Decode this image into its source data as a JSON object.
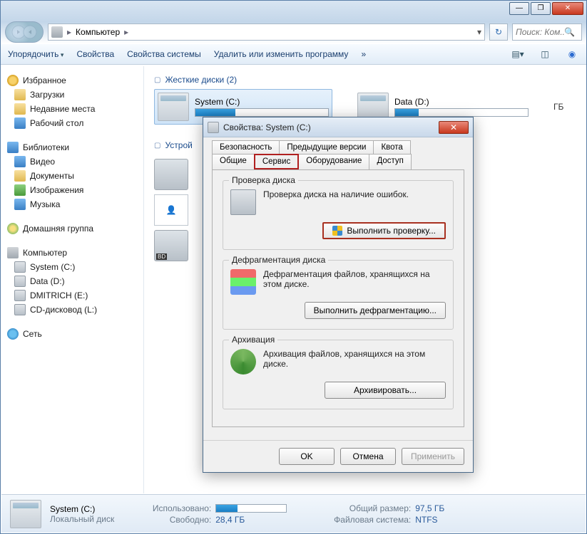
{
  "window_controls": {
    "min": "—",
    "max": "❐",
    "close": "✕"
  },
  "address": {
    "root_icon": "computer",
    "crumb1": "Компьютер",
    "search_placeholder": "Поиск: Ком..."
  },
  "toolbar": {
    "organize": "Упорядочить",
    "properties": "Свойства",
    "sys_properties": "Свойства системы",
    "uninstall": "Удалить или изменить программу",
    "more": "»"
  },
  "sidebar": {
    "favorites": {
      "label": "Избранное",
      "items": [
        "Загрузки",
        "Недавние места",
        "Рабочий стол"
      ]
    },
    "libraries": {
      "label": "Библиотеки",
      "items": [
        "Видео",
        "Документы",
        "Изображения",
        "Музыка"
      ]
    },
    "homegroup": {
      "label": "Домашняя группа"
    },
    "computer": {
      "label": "Компьютер",
      "items": [
        "System (C:)",
        "Data (D:)",
        "DMITRICH (E:)",
        "CD-дисковод (L:)"
      ]
    },
    "network": {
      "label": "Сеть"
    }
  },
  "content": {
    "hdd_header": "Жесткие диски (2)",
    "drives": [
      {
        "name": "System (C:)",
        "fill_pct": 30,
        "selected": true
      },
      {
        "name": "Data (D:)",
        "fill_pct": 18,
        "selected": false,
        "extra": "ГБ"
      }
    ],
    "devices_header": "Устрой"
  },
  "status": {
    "drive_name": "System (C:)",
    "type": "Локальный диск",
    "used_label": "Использовано:",
    "used_bar_pct": 30,
    "free_label": "Свободно:",
    "free_value": "28,4 ГБ",
    "total_label": "Общий размер:",
    "total_value": "97,5 ГБ",
    "fs_label": "Файловая система:",
    "fs_value": "NTFS"
  },
  "dialog": {
    "title": "Свойства: System (C:)",
    "tabs_row1": [
      "Безопасность",
      "Предыдущие версии",
      "Квота"
    ],
    "tabs_row2": [
      "Общие",
      "Сервис",
      "Оборудование",
      "Доступ"
    ],
    "active_tab": "Сервис",
    "check": {
      "legend": "Проверка диска",
      "text": "Проверка диска на наличие ошибок.",
      "button": "Выполнить проверку..."
    },
    "defrag": {
      "legend": "Дефрагментация диска",
      "text": "Дефрагментация файлов, хранящихся на этом диске.",
      "button": "Выполнить дефрагментацию..."
    },
    "backup": {
      "legend": "Архивация",
      "text": "Архивация файлов, хранящихся на этом диске.",
      "button": "Архивировать..."
    },
    "ok": "OK",
    "cancel": "Отмена",
    "apply": "Применить"
  }
}
